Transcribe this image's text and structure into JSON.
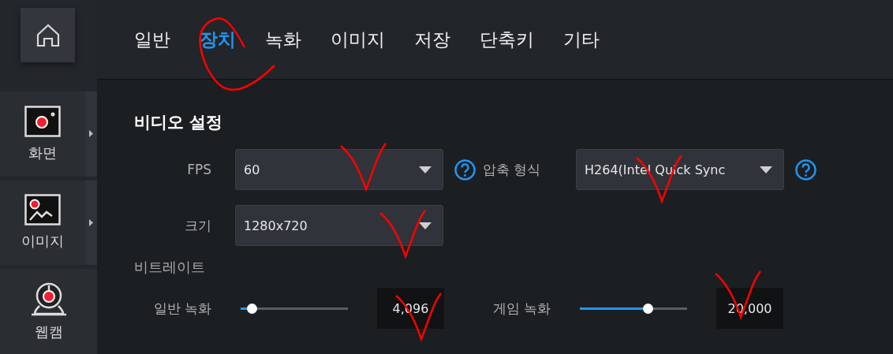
{
  "sidebar": {
    "home": {
      "selected": false
    },
    "items": [
      {
        "kind": "screen",
        "label": "화면"
      },
      {
        "kind": "image",
        "label": "이미지"
      },
      {
        "kind": "webcam",
        "label": "웹캠"
      }
    ]
  },
  "tabs": [
    {
      "label": "일반",
      "selected": false
    },
    {
      "label": "장치",
      "selected": true
    },
    {
      "label": "녹화",
      "selected": false
    },
    {
      "label": "이미지",
      "selected": false
    },
    {
      "label": "저장",
      "selected": false
    },
    {
      "label": "단축키",
      "selected": false
    },
    {
      "label": "기타",
      "selected": false
    }
  ],
  "section_title": "비디오 설정",
  "fps": {
    "label": "FPS",
    "value": "60"
  },
  "codec": {
    "label": "압축 형식",
    "value": "H264(Intel Quick Sync"
  },
  "size": {
    "label": "크기",
    "value": "1280x720"
  },
  "bitrate": {
    "title": "비트레이트",
    "sliders": [
      {
        "label": "일반 녹화",
        "level": 0.1,
        "value": "4,096"
      },
      {
        "label": "게임 녹화",
        "level": 0.63,
        "value": "20,000"
      }
    ]
  },
  "annotations": [
    {
      "kind": "circle"
    },
    {
      "kind": "check"
    },
    {
      "kind": "check"
    },
    {
      "kind": "check"
    },
    {
      "kind": "check"
    },
    {
      "kind": "check"
    }
  ]
}
